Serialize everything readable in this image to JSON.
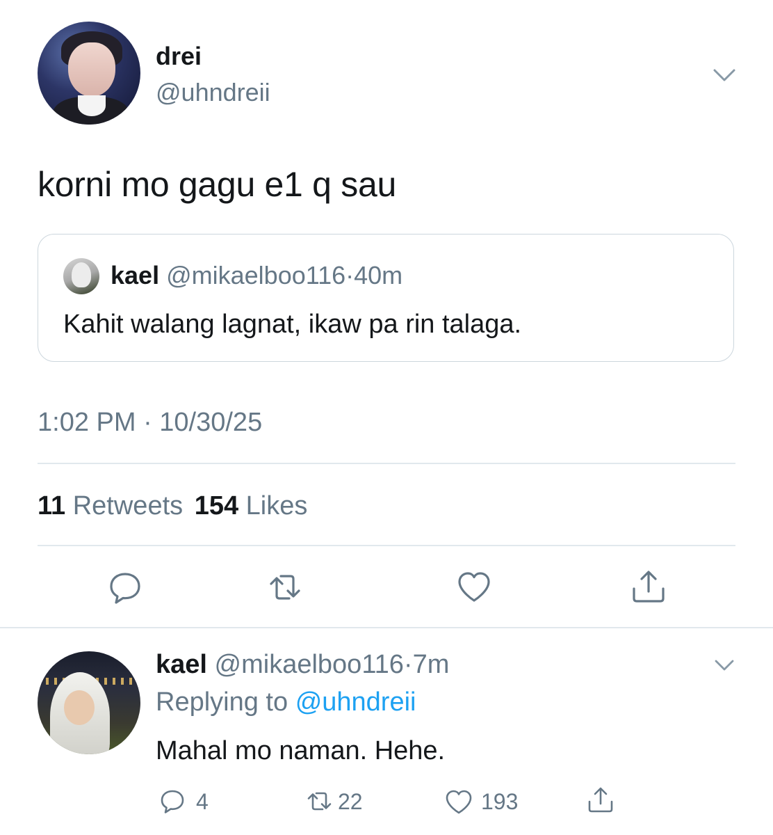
{
  "main_tweet": {
    "display_name": "drei",
    "handle": "@uhndreii",
    "text": "korni mo gagu e1 q sau",
    "avatar_icon": "user-avatar-photo",
    "menu_icon": "chevron-down-icon",
    "quoted": {
      "name": "kael",
      "handle": "@mikaelboo116",
      "separator": "·",
      "time": "40m",
      "text": "Kahit walang lagnat, ikaw pa rin talaga.",
      "avatar_icon": "user-avatar-photo"
    },
    "timestamp": "1:02 PM · 10/30/25",
    "stats": {
      "retweets_count": "11",
      "retweets_label": "Retweets",
      "likes_count": "154",
      "likes_label": "Likes"
    },
    "actions": [
      "reply-icon",
      "retweet-icon",
      "like-icon",
      "share-icon"
    ]
  },
  "reply_tweet": {
    "name": "kael",
    "handle": "@mikaelboo116",
    "separator": "·",
    "time": "7m",
    "replying_prefix": "Replying to",
    "replying_to": "@uhndreii",
    "text": "Mahal mo naman. Hehe.",
    "reply_count": "4",
    "retweet_count": "22",
    "like_count": "193",
    "menu_icon": "chevron-down-icon"
  },
  "colors": {
    "text_primary": "#14171a",
    "text_secondary": "#657786",
    "link": "#1da1f2",
    "border": "#e1e8ed"
  }
}
